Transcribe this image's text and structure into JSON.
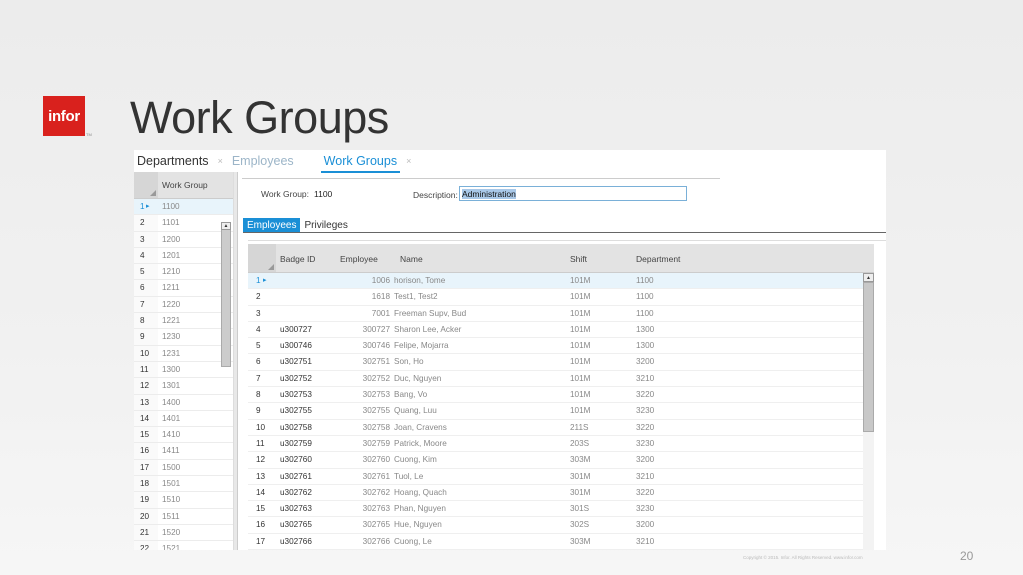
{
  "brand": {
    "logo_text": "infor",
    "logo_tm": "TM",
    "color": "#d9211d"
  },
  "slide": {
    "title": "Work Groups",
    "page_number": "20",
    "copyright": "Copyright © 2015. Infor. All Rights Reserved. www.infor.com"
  },
  "top_tabs": [
    {
      "label": "Departments",
      "close": "×"
    },
    {
      "label": "Employees",
      "close": ""
    },
    {
      "label": "Work Groups",
      "close": "×"
    }
  ],
  "left_grid": {
    "header": "Work Group",
    "rows": [
      {
        "n": "1",
        "marker": "▸",
        "v": "1100"
      },
      {
        "n": "2",
        "v": "1101"
      },
      {
        "n": "3",
        "v": "1200"
      },
      {
        "n": "4",
        "v": "1201"
      },
      {
        "n": "5",
        "v": "1210"
      },
      {
        "n": "6",
        "v": "1211"
      },
      {
        "n": "7",
        "v": "1220"
      },
      {
        "n": "8",
        "v": "1221"
      },
      {
        "n": "9",
        "v": "1230"
      },
      {
        "n": "10",
        "v": "1231"
      },
      {
        "n": "11",
        "v": "1300"
      },
      {
        "n": "12",
        "v": "1301"
      },
      {
        "n": "13",
        "v": "1400"
      },
      {
        "n": "14",
        "v": "1401"
      },
      {
        "n": "15",
        "v": "1410"
      },
      {
        "n": "16",
        "v": "1411"
      },
      {
        "n": "17",
        "v": "1500"
      },
      {
        "n": "18",
        "v": "1501"
      },
      {
        "n": "19",
        "v": "1510"
      },
      {
        "n": "20",
        "v": "1511"
      },
      {
        "n": "21",
        "v": "1520"
      },
      {
        "n": "22",
        "v": "1521"
      }
    ]
  },
  "form": {
    "work_group_label": "Work Group:",
    "work_group_value": "1100",
    "description_label": "Description:",
    "description_value": "Administration"
  },
  "sub_tabs": {
    "employees": "Employees",
    "privileges": "Privileges"
  },
  "emp_grid": {
    "headers": {
      "badge": "Badge ID",
      "employee": "Employee",
      "name": "Name",
      "shift": "Shift",
      "department": "Department"
    },
    "rows": [
      {
        "n": "1",
        "marker": "▸",
        "badge": "",
        "emp": "1006",
        "name": "horison, Tome",
        "shift": "101M",
        "dept": "1100"
      },
      {
        "n": "2",
        "badge": "",
        "emp": "1618",
        "name": "Test1, Test2",
        "shift": "101M",
        "dept": "1100"
      },
      {
        "n": "3",
        "badge": "",
        "emp": "7001",
        "name": "Freeman Supv, Bud",
        "shift": "101M",
        "dept": "1100"
      },
      {
        "n": "4",
        "badge": "u300727",
        "emp": "300727",
        "name": "Sharon Lee, Acker",
        "shift": "101M",
        "dept": "1300"
      },
      {
        "n": "5",
        "badge": "u300746",
        "emp": "300746",
        "name": "Felipe, Mojarra",
        "shift": "101M",
        "dept": "1300"
      },
      {
        "n": "6",
        "badge": "u302751",
        "emp": "302751",
        "name": "Son, Ho",
        "shift": "101M",
        "dept": "3200"
      },
      {
        "n": "7",
        "badge": "u302752",
        "emp": "302752",
        "name": "Duc, Nguyen",
        "shift": "101M",
        "dept": "3210"
      },
      {
        "n": "8",
        "badge": "u302753",
        "emp": "302753",
        "name": "Bang, Vo",
        "shift": "101M",
        "dept": "3220"
      },
      {
        "n": "9",
        "badge": "u302755",
        "emp": "302755",
        "name": "Quang, Luu",
        "shift": "101M",
        "dept": "3230"
      },
      {
        "n": "10",
        "badge": "u302758",
        "emp": "302758",
        "name": "Joan, Cravens",
        "shift": "211S",
        "dept": "3220"
      },
      {
        "n": "11",
        "badge": "u302759",
        "emp": "302759",
        "name": "Patrick, Moore",
        "shift": "203S",
        "dept": "3230"
      },
      {
        "n": "12",
        "badge": "u302760",
        "emp": "302760",
        "name": "Cuong, Kim",
        "shift": "303M",
        "dept": "3200"
      },
      {
        "n": "13",
        "badge": "u302761",
        "emp": "302761",
        "name": "Tuol, Le",
        "shift": "301M",
        "dept": "3210"
      },
      {
        "n": "14",
        "badge": "u302762",
        "emp": "302762",
        "name": "Hoang, Quach",
        "shift": "301M",
        "dept": "3220"
      },
      {
        "n": "15",
        "badge": "u302763",
        "emp": "302763",
        "name": "Phan, Nguyen",
        "shift": "301S",
        "dept": "3230"
      },
      {
        "n": "16",
        "badge": "u302765",
        "emp": "302765",
        "name": "Hue, Nguyen",
        "shift": "302S",
        "dept": "3200"
      },
      {
        "n": "17",
        "badge": "u302766",
        "emp": "302766",
        "name": "Cuong, Le",
        "shift": "303M",
        "dept": "3210"
      }
    ]
  }
}
